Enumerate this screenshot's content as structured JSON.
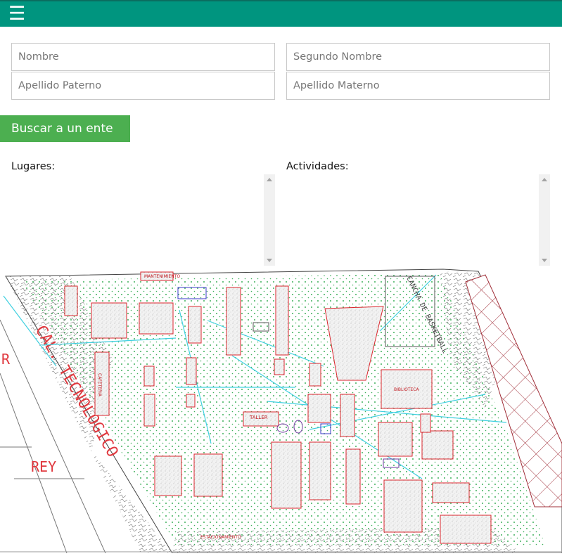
{
  "header": {
    "menu_icon": "hamburger-menu-icon",
    "menu_glyph": "☰",
    "background_color": "#00957f"
  },
  "form": {
    "nombre_placeholder": "Nombre",
    "segundo_nombre_placeholder": "Segundo Nombre",
    "apellido_paterno_placeholder": "Apellido Paterno",
    "apellido_materno_placeholder": "Apellido Materno",
    "search_button_label": "Buscar a un ente",
    "search_button_color": "#4caf50"
  },
  "lists": {
    "lugares_label": "Lugares:",
    "actividades_label": "Actividades:"
  },
  "map": {
    "street_labels": [
      "CAL. TECNOLOGICO",
      "REY",
      "R"
    ],
    "court_label": "CANCHA DE BASKETBALL",
    "area_labels": [
      "TALLER",
      "BIBLIOTECA",
      "MANTENIMIENTO",
      "ESTACIONAMIENTO",
      "CAFETERIA"
    ],
    "line_color_buildings": "#d9262c",
    "line_color_paths": "#3fd0e0",
    "fill_color_green": "#28a745"
  }
}
